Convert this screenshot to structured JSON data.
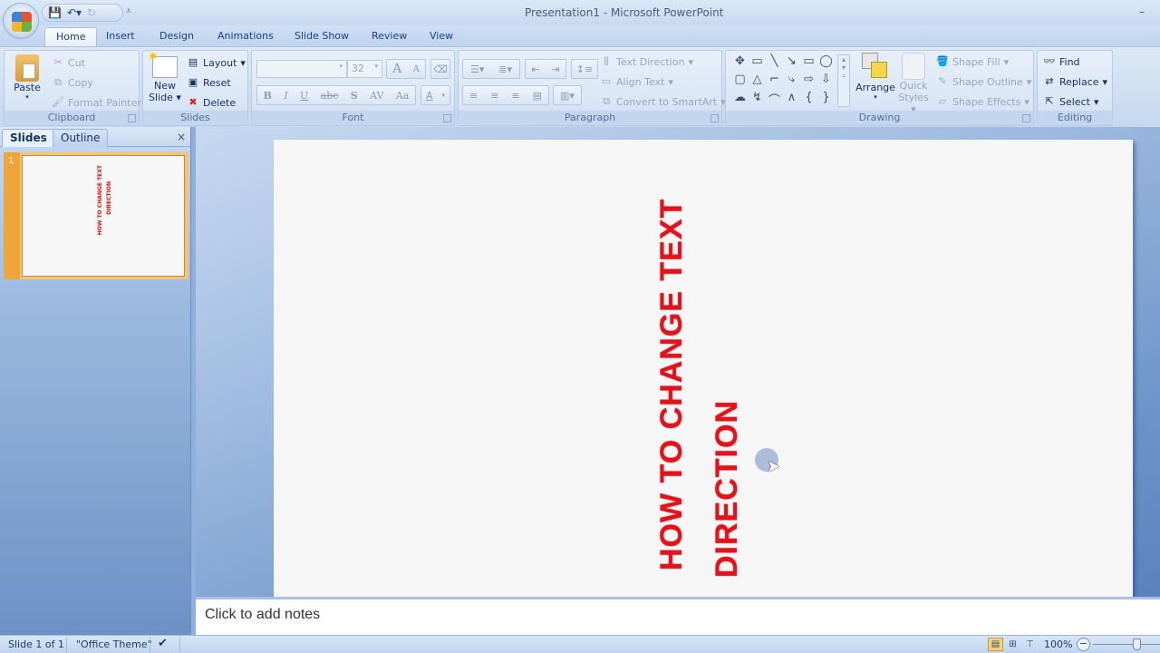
{
  "window": {
    "title": "Presentation1 - Microsoft PowerPoint",
    "minimize_glyph": "–"
  },
  "quick_access": {
    "save_icon": "save-icon",
    "undo_icon": "undo-icon",
    "redo_icon": "redo-icon",
    "customize_glyph": "⩡"
  },
  "tabs": [
    "Home",
    "Insert",
    "Design",
    "Animations",
    "Slide Show",
    "Review",
    "View"
  ],
  "active_tab": "Home",
  "ribbon": {
    "clipboard": {
      "label": "Clipboard",
      "paste": "Paste",
      "cut": "Cut",
      "copy": "Copy",
      "format_painter": "Format Painter"
    },
    "slides": {
      "label": "Slides",
      "new_slide_1": "New",
      "new_slide_2": "Slide",
      "layout": "Layout",
      "reset": "Reset",
      "delete": "Delete"
    },
    "font": {
      "label": "Font",
      "font_name": "",
      "font_size": "32",
      "grow": "A",
      "shrink": "A",
      "bold": "B",
      "italic": "I",
      "underline": "U",
      "strikethrough": "abc",
      "shadow": "S",
      "spacing": "AV",
      "case": "Aa",
      "color": "A"
    },
    "paragraph": {
      "label": "Paragraph",
      "text_direction": "Text Direction",
      "align_text": "Align Text",
      "convert_smartart": "Convert to SmartArt"
    },
    "drawing": {
      "label": "Drawing",
      "arrange": "Arrange",
      "quick_styles_1": "Quick",
      "quick_styles_2": "Styles",
      "shape_fill": "Shape Fill",
      "shape_outline": "Shape Outline",
      "shape_effects": "Shape Effects",
      "shapes": [
        "✥",
        "▭",
        "╲",
        "↘",
        "▭",
        "◯",
        "▢",
        "△",
        "⌐",
        "⤷",
        "⇨",
        "⇩",
        "☁",
        "↯",
        "⌒",
        "∧",
        "{",
        "}"
      ]
    },
    "editing": {
      "label": "Editing",
      "find": "Find",
      "replace": "Replace",
      "select": "Select"
    }
  },
  "left_pane": {
    "tabs": [
      "Slides",
      "Outline"
    ],
    "close": "×",
    "slide_number": "1"
  },
  "slide": {
    "lines": [
      "HOW TO CHANGE TEXT",
      "DIRECTION"
    ],
    "text_color": "#e3121b"
  },
  "notes": {
    "placeholder": "Click to add notes"
  },
  "status": {
    "slide": "Slide 1 of 1",
    "theme": "\"Office Theme\"",
    "zoom": "100%"
  }
}
